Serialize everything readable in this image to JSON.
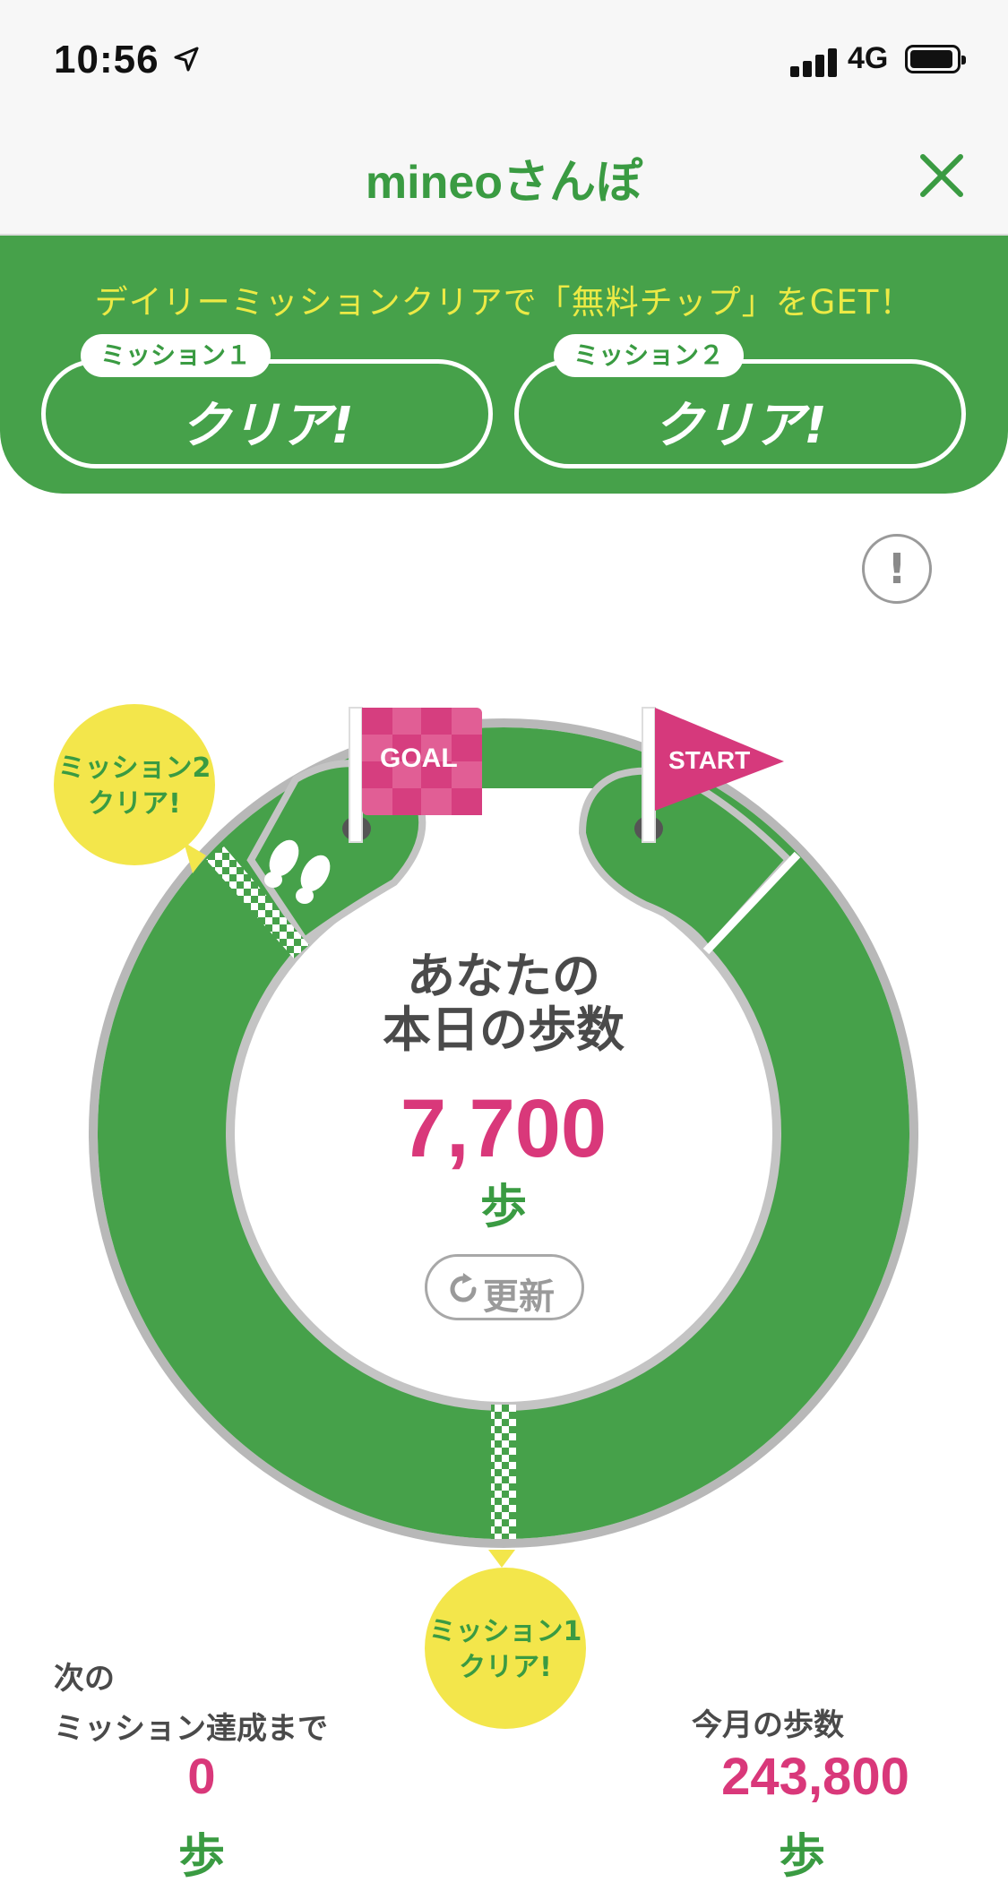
{
  "status_bar": {
    "time": "10:56",
    "network": "4G"
  },
  "nav": {
    "title": "mineoさんぽ"
  },
  "banner": {
    "text": "デイリーミッションクリアで「無料チップ」をGET！",
    "missions": [
      {
        "tag": "ミッション１",
        "status": "クリア!"
      },
      {
        "tag": "ミッション２",
        "status": "クリア!"
      }
    ]
  },
  "info_button": {
    "label": "!"
  },
  "course": {
    "goal_label": "GOAL",
    "start_label": "START",
    "mission2_bubble": [
      "ミッション2",
      "クリア!"
    ],
    "mission1_bubble": [
      "ミッション1",
      "クリア!"
    ]
  },
  "today": {
    "title_line1": "あなたの",
    "title_line2": "本日の歩数",
    "steps": "7,700",
    "unit": "歩",
    "refresh_label": "更新"
  },
  "next_mission": {
    "label_line1": "次の",
    "label_line2": "ミッション達成まで",
    "steps": "0",
    "unit": "歩"
  },
  "month": {
    "label": "今月の歩数",
    "steps": "243,800",
    "unit": "歩"
  },
  "colors": {
    "brand_green": "#46a14a",
    "accent_pink": "#d9387a",
    "banner_text_yellow": "#ecea45",
    "bubble_yellow": "#f3e64b"
  }
}
